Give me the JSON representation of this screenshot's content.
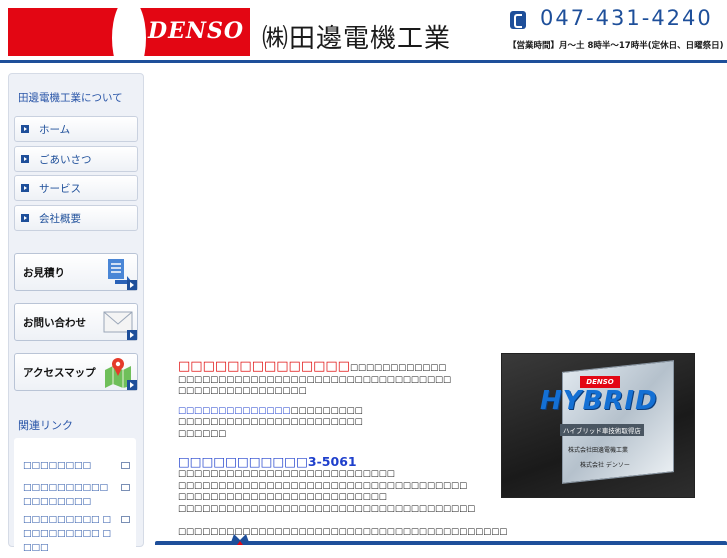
{
  "header": {
    "brand": "DENSO",
    "company": "㈱田邊電機工業",
    "phone": "047-431-4240",
    "hours": "【営業時間】月〜土 8時半〜17時半(定休日、日曜祭日)",
    "colors": {
      "brand_red": "#e30613",
      "accent_blue": "#1e4f9a"
    }
  },
  "sidebar": {
    "title": "田邊電機工業について",
    "nav": [
      {
        "label": "ホーム"
      },
      {
        "label": "ごあいさつ"
      },
      {
        "label": "サービス"
      },
      {
        "label": "会社概要"
      }
    ],
    "buttons": [
      {
        "label": "お見積り",
        "icon": "document-arrow-icon"
      },
      {
        "label": "お問い合わせ",
        "icon": "envelope-icon"
      },
      {
        "label": "アクセスマップ",
        "icon": "map-pin-icon"
      }
    ],
    "related_title": "関連リンク",
    "related_links": [
      {
        "label": "□□□□□□□□"
      },
      {
        "label": "□□□□□□□□□□ □□□□□□□□"
      },
      {
        "label": "□□□□□□□□□ □□□□□□□□□□ □□□□"
      }
    ]
  },
  "main": {
    "section1": {
      "heading": "□□□□□□□□□□□□□□",
      "heading_suffix": "□□□□□□□□□□□□",
      "lines": [
        "□□□□□□□□□□□□□□□□□□□□□□□□□□□□□□□□□□",
        "□□□□□□□□□□□□□□□□",
        "□□□□□□□□□□□□□□□□□□□□□□□□□□",
        "□□□□□□□□□□□□□□□□□□□□□□□",
        "□□□□□□"
      ],
      "blue_line_prefix": "□□□□□□□□□□□□□□"
    },
    "section2": {
      "heading": "□□□□□□□□□□□3-5061",
      "lines": [
        "□□□□□□□□□□□□□□□□□□□□□□□□□□□",
        "□□□□□□□□□□□□□□□□□□□□□□□□□□□□□□□□□□□□",
        "□□□□□□□□□□□□□□□□□□□□□□□□□□",
        "□□□□□□□□□□□□□□□□□□□□□□□□□□□□□□□□□□□□□"
      ],
      "footer_line": "□□□□□□□□□□□□□□□□□□□□□□□□□□□□□□□□□□□□□□□□□"
    },
    "photo": {
      "brand": "DENSO",
      "title": "HYBRID",
      "subtitle": "ハイブリッド車技術取得店",
      "company": "株式会社田邊電機工業",
      "company2": "株式会社 デンソー"
    }
  }
}
